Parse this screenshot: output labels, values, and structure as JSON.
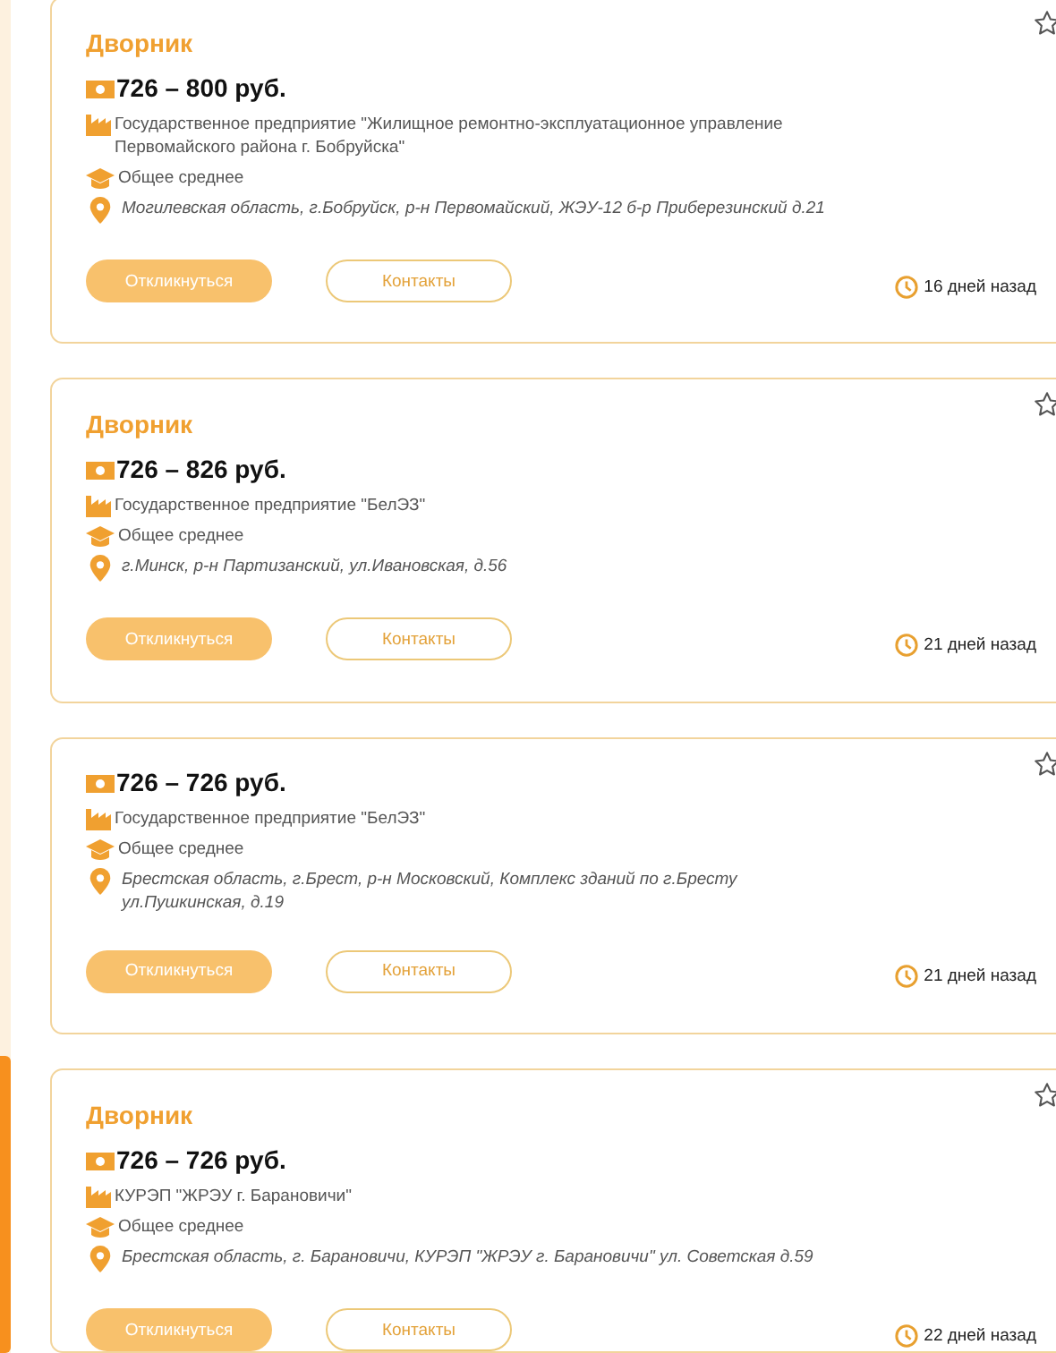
{
  "vacancies": [
    {
      "title": "Дворник",
      "salary": "726 – 800 руб.",
      "company": "Государственное предприятие \"Жилищное ремонтно-эксплуатационное управление Первомайского района г. Бобруйска\"",
      "education": "Общее среднее",
      "address": "Могилевская область, г.Бобруйск, р-н Первомайский, ЖЭУ-12 б-р Приберезинский д.21",
      "apply_button": "Откликнуться",
      "contacts_button": "Контакты",
      "posted": "16 дней назад",
      "favorite": false
    },
    {
      "title": "Дворник",
      "salary": "726 – 826 руб.",
      "company": "Государственное предприятие \"БелЭЗ\"",
      "education": "Общее среднее",
      "address": "г.Минск, р-н Партизанский, ул.Ивановская, д.56",
      "apply_button": "Откликнуться",
      "contacts_button": "Контакты",
      "posted": "21 дней назад",
      "favorite": false
    },
    {
      "salary": "726 – 726 руб.",
      "company": "Государственное предприятие \"БелЭЗ\"",
      "education": "Общее среднее",
      "address": "Брестская область, г.Брест, р-н Московский, Комплекс зданий по г.Бресту ул.Пушкинская, д.19",
      "apply_button": "Откликнуться",
      "contacts_button": "Контакты",
      "posted": "21 дней назад",
      "favorite": false
    },
    {
      "title": "Дворник",
      "salary": "726 – 726 руб.",
      "company": "КУРЭП \"ЖРЭУ г. Барановичи\"",
      "education": "Общее среднее",
      "address": "Брестская область, г. Барановичи, КУРЭП \"ЖРЭУ г. Барановичи\" ул. Советская д.59",
      "apply_button": "Откликнуться",
      "contacts_button": "Контакты",
      "posted": "22 дней назад",
      "favorite": false
    }
  ]
}
